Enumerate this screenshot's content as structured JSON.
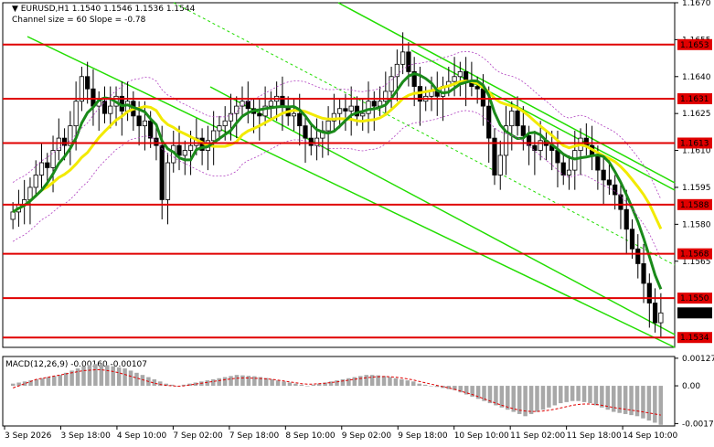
{
  "header": {
    "symbol_line": "EURUSD,H1  1.1540 1.1546 1.1536 1.1544",
    "channel_line": "Channel size = 60 Slope = -0.78"
  },
  "colors": {
    "bull_candle": "#000000",
    "bear_candle": "#000000",
    "level_line": "#e00000",
    "price_label_bg": "#e00000",
    "current_label_bg": "#000000",
    "channel_line": "#22dd00",
    "ma_fast": "#1a8a1a",
    "ma_slow": "#f2ea00",
    "envelope": "#b040c0",
    "macd_hist": "#a8a8a8",
    "macd_signal": "#e00000"
  },
  "chart_data": [
    {
      "type": "candlestick",
      "symbol": "EURUSD",
      "timeframe": "H1",
      "ohlc_last": {
        "open": 1.154,
        "high": 1.1546,
        "low": 1.1536,
        "close": 1.1544
      },
      "y_axis_ticks": [
        "1.1670",
        "1.1655",
        "1.1640",
        "1.1625",
        "1.1610",
        "1.1595",
        "1.1580",
        "1.1565"
      ],
      "ylim": [
        1.153,
        1.167
      ],
      "x_axis_ticks": [
        "3 Sep 2026",
        "3 Sep 18:00",
        "4 Sep 10:00",
        "7 Sep 02:00",
        "7 Sep 18:00",
        "8 Sep 10:00",
        "9 Sep 02:00",
        "9 Sep 18:00",
        "10 Sep 10:00",
        "11 Sep 02:00",
        "11 Sep 18:00",
        "14 Sep 10:00"
      ],
      "levels": [
        "1.1653",
        "1.1631",
        "1.1613",
        "1.1588",
        "1.1568",
        "1.1550",
        "1.1534"
      ],
      "current_price": "1.1544",
      "close_series": [
        1.1585,
        1.1588,
        1.159,
        1.1595,
        1.16,
        1.1605,
        1.1603,
        1.161,
        1.1615,
        1.1612,
        1.162,
        1.163,
        1.164,
        1.1635,
        1.1628,
        1.163,
        1.1625,
        1.1628,
        1.1632,
        1.1626,
        1.163,
        1.1624,
        1.162,
        1.1622,
        1.1615,
        1.1612,
        1.159,
        1.1605,
        1.1612,
        1.1608,
        1.161,
        1.1612,
        1.1615,
        1.161,
        1.1614,
        1.1618,
        1.162,
        1.1622,
        1.1625,
        1.1628,
        1.163,
        1.1627,
        1.1625,
        1.1624,
        1.1628,
        1.163,
        1.1632,
        1.1628,
        1.1624,
        1.1625,
        1.162,
        1.1615,
        1.1612,
        1.1615,
        1.1618,
        1.1622,
        1.1625,
        1.1627,
        1.1626,
        1.1628,
        1.1624,
        1.1625,
        1.163,
        1.1628,
        1.163,
        1.1634,
        1.164,
        1.1645,
        1.165,
        1.1642,
        1.1636,
        1.163,
        1.1632,
        1.1634,
        1.1632,
        1.1636,
        1.1638,
        1.164,
        1.1642,
        1.1638,
        1.1636,
        1.1635,
        1.1628,
        1.1615,
        1.16,
        1.1608,
        1.162,
        1.1626,
        1.162,
        1.1616,
        1.1612,
        1.161,
        1.1614,
        1.1612,
        1.161,
        1.1605,
        1.16,
        1.1602,
        1.161,
        1.1615,
        1.1612,
        1.1608,
        1.1602,
        1.1598,
        1.1596,
        1.1592,
        1.1586,
        1.1578,
        1.157,
        1.1564,
        1.1556,
        1.1548,
        1.154,
        1.1544
      ]
    },
    {
      "type": "bar",
      "title": "MACD(12,26,9) -0.00160 -0.00107",
      "y_axis_ticks": [
        "0.00127",
        "0.00",
        "-0.00174"
      ],
      "ylim": [
        -0.00185,
        0.00135
      ],
      "hist_values": [
        0.0001,
        0.00015,
        0.0002,
        0.00025,
        0.0003,
        0.00035,
        0.0004,
        0.00045,
        0.0005,
        0.0006,
        0.0007,
        0.0008,
        0.0009,
        0.00095,
        0.001,
        0.001,
        0.00095,
        0.0009,
        0.00085,
        0.0008,
        0.0007,
        0.0006,
        0.0005,
        0.0004,
        0.0003,
        0.0002,
        0.0001,
        5e-05,
        0,
        5e-05,
        0.0001,
        0.00015,
        0.0002,
        0.00025,
        0.0003,
        0.00035,
        0.0004,
        0.00045,
        0.0005,
        0.00048,
        0.00046,
        0.00044,
        0.0004,
        0.00036,
        0.0003,
        0.00025,
        0.0002,
        0.00015,
        0.0001,
        5e-05,
        0,
        5e-05,
        0.0001,
        0.00015,
        0.0002,
        0.00025,
        0.0003,
        0.00035,
        0.0004,
        0.00045,
        0.0005,
        0.0005,
        0.00048,
        0.00045,
        0.0004,
        0.00035,
        0.0003,
        0.00025,
        0.0002,
        0.0001,
        5e-05,
        0,
        -5e-05,
        -0.0001,
        -0.00015,
        -0.0002,
        -0.0003,
        -0.0004,
        -0.0005,
        -0.0006,
        -0.0007,
        -0.0008,
        -0.0009,
        -0.001,
        -0.0011,
        -0.0012,
        -0.0013,
        -0.0014,
        -0.0013,
        -0.0012,
        -0.0011,
        -0.001,
        -0.0009,
        -0.0008,
        -0.00075,
        -0.0007,
        -0.0007,
        -0.00075,
        -0.0008,
        -0.0009,
        -0.001,
        -0.0011,
        -0.0012,
        -0.00125,
        -0.0013,
        -0.00135,
        -0.0014,
        -0.0015,
        -0.0016,
        -0.0017,
        -0.0018
      ],
      "signal_values": [
        -0.0001,
        0,
        0.0001,
        0.0002,
        0.0003,
        0.00035,
        0.0004,
        0.00045,
        0.0005,
        0.00055,
        0.0006,
        0.00065,
        0.0007,
        0.00072,
        0.00074,
        0.00074,
        0.0007,
        0.00066,
        0.0006,
        0.00052,
        0.00044,
        0.00036,
        0.00028,
        0.0002,
        0.00012,
        6e-05,
        2e-05,
        0,
        -2e-05,
        0,
        4e-05,
        8e-05,
        0.00012,
        0.00016,
        0.0002,
        0.00024,
        0.00028,
        0.00032,
        0.00035,
        0.00036,
        0.00036,
        0.00035,
        0.00034,
        0.00032,
        0.0003,
        0.00026,
        0.00022,
        0.00018,
        0.00014,
        0.0001,
        8e-05,
        8e-05,
        0.0001,
        0.00012,
        0.00015,
        0.00018,
        0.00022,
        0.00026,
        0.0003,
        0.00034,
        0.00037,
        0.0004,
        0.00042,
        0.00043,
        0.00042,
        0.0004,
        0.00036,
        0.00032,
        0.00027,
        0.0002,
        0.00014,
        8e-05,
        2e-05,
        -4e-05,
        -0.0001,
        -0.00016,
        -0.00024,
        -0.00032,
        -0.0004,
        -0.0005,
        -0.0006,
        -0.0007,
        -0.0008,
        -0.0009,
        -0.00098,
        -0.00106,
        -0.00112,
        -0.00116,
        -0.00118,
        -0.00118,
        -0.00116,
        -0.00112,
        -0.00108,
        -0.00102,
        -0.00096,
        -0.0009,
        -0.00086,
        -0.00084,
        -0.00084,
        -0.00086,
        -0.0009,
        -0.00095,
        -0.001,
        -0.00104,
        -0.00108,
        -0.00112,
        -0.00116,
        -0.0012,
        -0.00125,
        -0.0013,
        -0.00135
      ]
    }
  ]
}
